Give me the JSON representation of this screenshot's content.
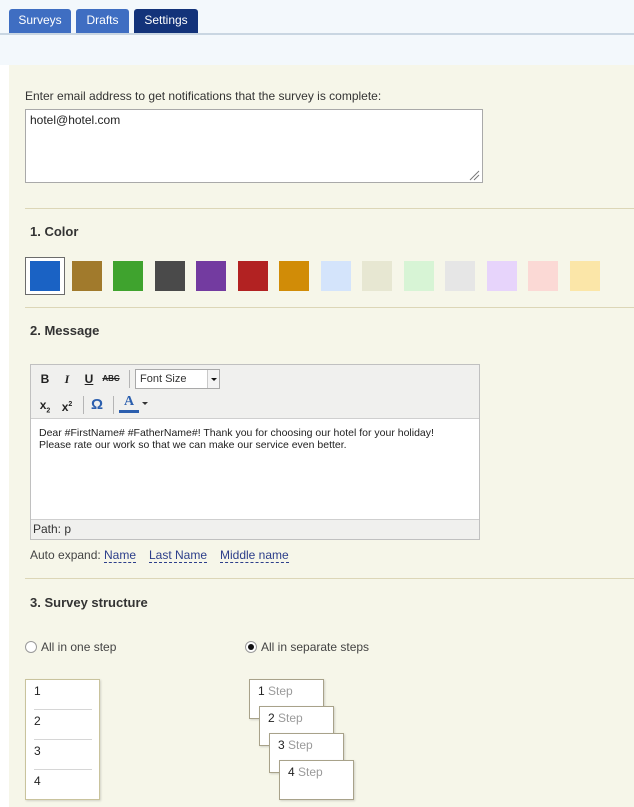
{
  "tabs": [
    {
      "label": "Surveys",
      "active": false
    },
    {
      "label": "Drafts",
      "active": false
    },
    {
      "label": "Settings",
      "active": true
    }
  ],
  "notification": {
    "label": "Enter email address to get notifications that the survey is complete:",
    "email_value": "hotel@hotel.com"
  },
  "color_section": {
    "title": "1. Color",
    "swatches": [
      "#1a62c4",
      "#a17a2c",
      "#3fa32e",
      "#4a4a4a",
      "#733ba0",
      "#b22222",
      "#d18c07",
      "#d4e4fb",
      "#e7e7d2",
      "#d7f4d5",
      "#e6e6e6",
      "#e7d4fb",
      "#fbd9d5",
      "#fbe6a8"
    ],
    "selected_index": 0
  },
  "message_section": {
    "title": "2. Message",
    "toolbar": {
      "bold_glyph": "B",
      "italic_glyph": "I",
      "underline_glyph": "U",
      "strike_glyph": "ABC",
      "font_size_label": "Font Size",
      "subscript_glyph": "x",
      "superscript_glyph": "x",
      "omega_glyph": "Ω",
      "text_color_glyph": "A"
    },
    "body_line1": "Dear #FirstName# #FatherName#! Thank you for choosing our hotel for your holiday!",
    "body_line2": "Please rate our work so that we can make our service even better.",
    "path_label": "Path: p",
    "auto_expand_label": "Auto expand:",
    "auto_expand_links": [
      "Name",
      "Last Name",
      "Middle name"
    ]
  },
  "structure_section": {
    "title": "3. Survey structure",
    "option_one_step": "All in one step",
    "option_separate": "All in separate steps",
    "selected_option": "separate",
    "one_step_items": [
      "1",
      "2",
      "3",
      "4"
    ],
    "separate_steps": [
      {
        "num": "1",
        "word": "Step"
      },
      {
        "num": "2",
        "word": "Step"
      },
      {
        "num": "3",
        "word": "Step"
      },
      {
        "num": "4",
        "word": "Step"
      }
    ]
  }
}
